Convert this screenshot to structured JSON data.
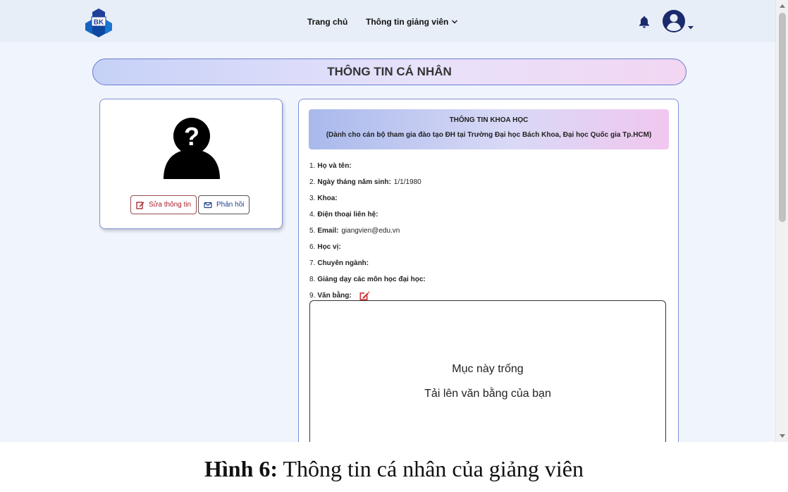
{
  "navbar": {
    "logo_text": "BK",
    "home_label": "Trang chủ",
    "teacher_info_label": "Thông tin giảng viên",
    "icons": {
      "logo": "bk-logo-icon",
      "dropdown": "chevron-down-icon",
      "notification": "bell-icon",
      "account": "user-circle-icon"
    }
  },
  "page": {
    "title": "THÔNG TIN CÁ NHÂN"
  },
  "profile_card": {
    "avatar_icon": "unknown-person-icon",
    "edit_button": "Sửa thông tin",
    "feedback_button": "Phản hồi"
  },
  "science_info": {
    "title": "THÔNG TIN KHOA HỌC",
    "subtitle": "(Dành cho cán bộ tham gia đào tạo ĐH tại Trường Đại học Bách Khoa, Đại học Quốc gia Tp.HCM)",
    "fields": [
      {
        "num": "1.",
        "label": "Họ và tên:",
        "value": ""
      },
      {
        "num": "2.",
        "label": "Ngày tháng năm sinh:",
        "value": "1/1/1980"
      },
      {
        "num": "3.",
        "label": "Khoa:",
        "value": ""
      },
      {
        "num": "4.",
        "label": "Điện thoại liên hệ:",
        "value": ""
      },
      {
        "num": "5.",
        "label": "Email:",
        "value": "giangvien@edu.vn"
      },
      {
        "num": "6.",
        "label": "Học vị:",
        "value": ""
      },
      {
        "num": "7.",
        "label": "Chuyên ngành:",
        "value": ""
      },
      {
        "num": "8.",
        "label": "Giảng dạy các môn học đại học:",
        "value": ""
      },
      {
        "num": "9.",
        "label": "Văn bằng:",
        "value": ""
      }
    ],
    "degree_empty": "Mục này trống",
    "degree_upload": "Tải lên văn bằng của bạn"
  },
  "caption": {
    "prefix": "Hình 6:",
    "text": " Thông tin cá nhân của giảng viên"
  },
  "colors": {
    "accent_blue": "#1a2a6c",
    "edit_red": "#d32f2f",
    "title_border": "#6b7ad1"
  }
}
